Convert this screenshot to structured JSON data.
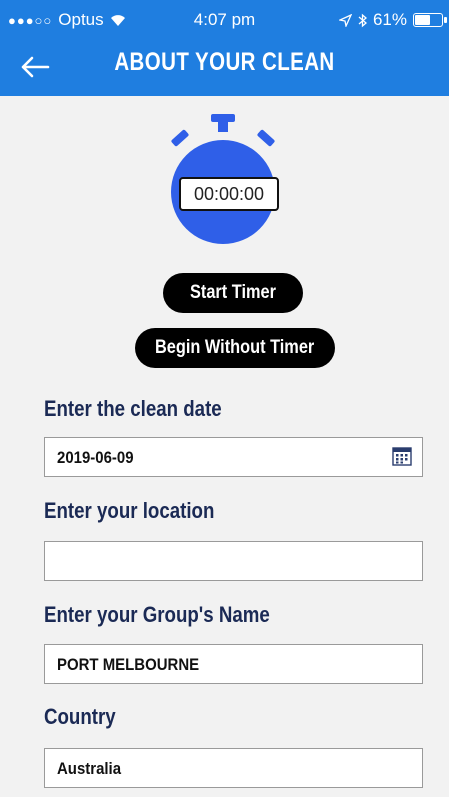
{
  "status_bar": {
    "carrier": "Optus",
    "time": "4:07 pm",
    "battery_percent": "61%",
    "battery_level": 0.61
  },
  "header": {
    "title": "ABOUT YOUR CLEAN"
  },
  "timer": {
    "display": "00:00:00",
    "start_label": "Start Timer",
    "begin_without_label": "Begin Without Timer"
  },
  "form": {
    "date": {
      "label": "Enter the clean date",
      "value": "2019-06-09"
    },
    "location": {
      "label": "Enter your location",
      "value": ""
    },
    "group": {
      "label": "Enter your Group's Name",
      "value": "PORT MELBOURNE"
    },
    "country": {
      "label": "Country",
      "value": "Australia"
    }
  },
  "colors": {
    "header": "#1f7ee0",
    "timer_blue": "#2f5fe8",
    "label_navy": "#1b2a55"
  }
}
